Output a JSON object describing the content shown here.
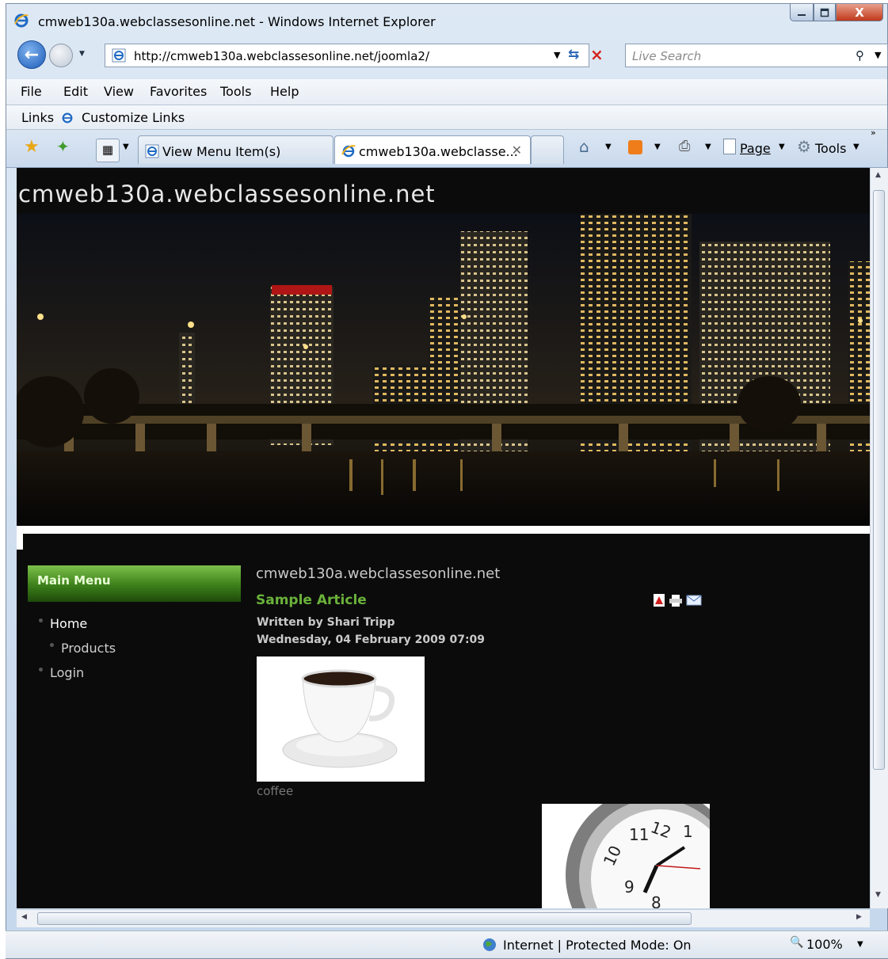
{
  "window": {
    "title": "cmweb130a.webclassesonline.net - Windows Internet Explorer",
    "close_glyph": "X"
  },
  "address_bar": {
    "url": "http://cmweb130a.webclassesonline.net/joomla2/",
    "search_placeholder": "Live Search"
  },
  "menu": [
    "File",
    "Edit",
    "View",
    "Favorites",
    "Tools",
    "Help"
  ],
  "links_bar": {
    "links_label": "Links",
    "customize_label": "Customize Links"
  },
  "tabs": [
    {
      "label": "View Menu Item(s)",
      "active": false
    },
    {
      "label": "cmweb130a.webclasse...",
      "active": true
    }
  ],
  "command_bar": {
    "page_label": "Page",
    "tools_label": "Tools"
  },
  "site": {
    "title": "cmweb130a.webclassesonline.net",
    "main_menu": {
      "header": "Main Menu",
      "items": [
        {
          "label": "Home",
          "active": true
        },
        {
          "label": "Products",
          "active": false
        },
        {
          "label": "Login",
          "active": false
        }
      ]
    },
    "content": {
      "site_heading": "cmweb130a.webclassesonline.net",
      "article_title": "Sample Article",
      "author": "Written by Shari Tripp",
      "date": "Wednesday, 04 February 2009 07:09",
      "image_caption": "coffee"
    },
    "accent_color": "#6ab23b"
  },
  "status_bar": {
    "zone": "Internet | Protected Mode: On",
    "zoom": "100%"
  }
}
